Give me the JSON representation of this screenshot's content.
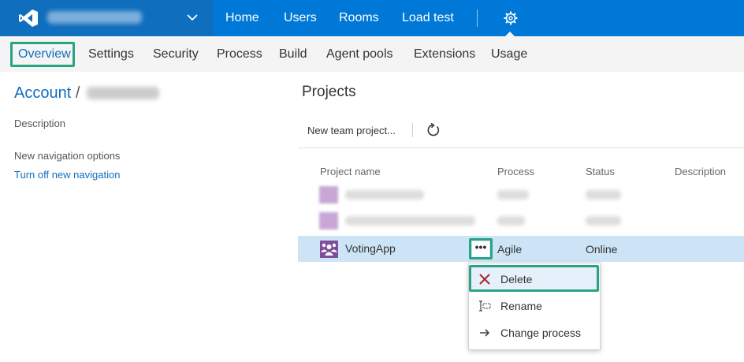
{
  "topbar": {
    "account_name_redacted": "",
    "nav": [
      "Home",
      "Users",
      "Rooms",
      "Load test"
    ]
  },
  "subnav": {
    "items": [
      "Overview",
      "Settings",
      "Security",
      "Process",
      "Build",
      "Agent pools",
      "Extensions",
      "Usage"
    ],
    "active": "Overview"
  },
  "left": {
    "breadcrumb_root": "Account",
    "breadcrumb_sep": "/",
    "description_label": "Description",
    "nav_options_label": "New navigation options",
    "nav_toggle_link": "Turn off new navigation"
  },
  "projects": {
    "title": "Projects",
    "new_button": "New team project...",
    "columns": [
      "Project name",
      "Process",
      "Status",
      "Description"
    ],
    "selected_row": {
      "name": "VotingApp",
      "process": "Agile",
      "status": "Online",
      "more": "•••"
    }
  },
  "context_menu": {
    "items": [
      {
        "label": "Delete",
        "icon": "delete-x-icon"
      },
      {
        "label": "Rename",
        "icon": "rename-icon"
      },
      {
        "label": "Change process",
        "icon": "arrow-right-icon"
      }
    ]
  },
  "colors": {
    "brand_blue": "#0078d7",
    "selection": "#cce4f6",
    "highlight_box": "#2aa384",
    "delete_red": "#a4262c"
  }
}
